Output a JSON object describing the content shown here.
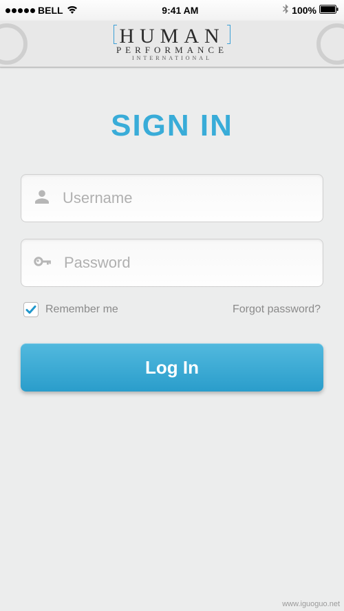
{
  "status_bar": {
    "carrier": "BELL",
    "time": "9:41 AM",
    "battery": "100%"
  },
  "header": {
    "logo_main": "HUMAN",
    "logo_sub": "PERFORMANCE",
    "logo_tag": "INTERNATIONAL"
  },
  "signin": {
    "title": "SIGN IN",
    "username_placeholder": "Username",
    "username_value": "",
    "password_placeholder": "Password",
    "password_value": "",
    "remember_label": "Remember me",
    "remember_checked": true,
    "forgot_label": "Forgot password?",
    "login_label": "Log In"
  },
  "colors": {
    "accent": "#39acd8",
    "button_top": "#52b9de",
    "button_bottom": "#2a9dcb"
  },
  "watermark": "www.iguoguo.net"
}
